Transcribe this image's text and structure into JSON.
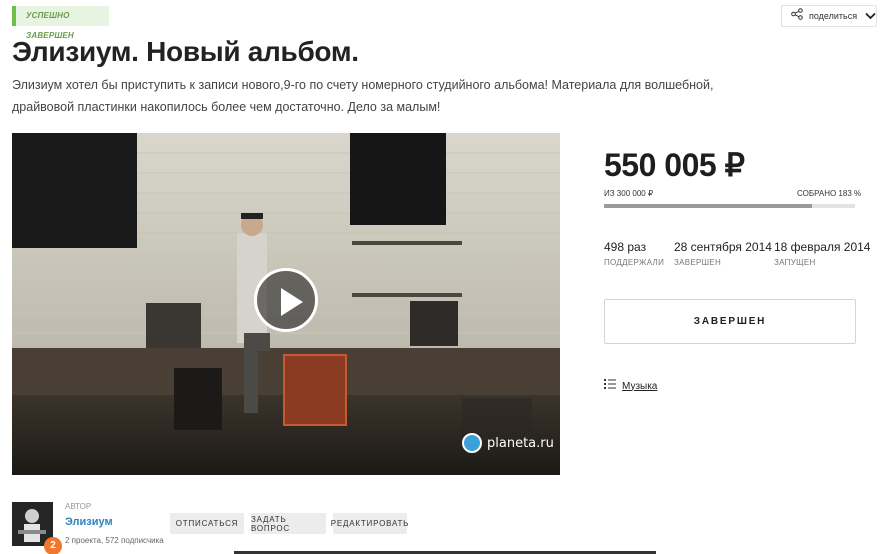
{
  "status": {
    "label": "УСПЕШНО ЗАВЕРШЕН"
  },
  "share": {
    "label": "поделиться",
    "icon": "share-icon",
    "chevron": "chevron-down-icon"
  },
  "project": {
    "title": "Элизиум. Новый альбом.",
    "description": "Элизиум хотел бы приступить к записи нового,9-го по счету номерного студийного альбома! Материала для волшебной, драйвовой пластинки накопилось более чем достаточно. Дело за малым!"
  },
  "video": {
    "play_icon": "play-icon",
    "watermark": "planeta.ru"
  },
  "funding": {
    "amount": "550 005 ₽",
    "goal": "ИЗ 300 000 ₽",
    "collected": "СОБРАНО 183 %",
    "progress": 0.83
  },
  "stats": [
    {
      "value": "498 раз",
      "label": "ПОДДЕРЖАЛИ"
    },
    {
      "value": "28 сентября 2014",
      "label": "ЗАВЕРШЕН"
    },
    {
      "value": "18 февраля 2014",
      "label": "ЗАПУЩЕН"
    }
  ],
  "finished_button": {
    "label": "ЗАВЕРШЕН"
  },
  "category": {
    "label": "Музыка",
    "icon": "list-icon"
  },
  "author": {
    "heading": "АВТОР",
    "name": "Элизиум",
    "stats": "2 проекта, 572 подписчика",
    "badge": "2"
  },
  "actions": {
    "unsubscribe": "ОТПИСАТЬСЯ",
    "ask": "ЗАДАТЬ ВОПРОС",
    "edit": "РЕДАКТИРОВАТЬ"
  },
  "colors": {
    "accent_green": "#6cc04a",
    "link_blue": "#2b84c2",
    "badge_orange": "#f0782e"
  }
}
